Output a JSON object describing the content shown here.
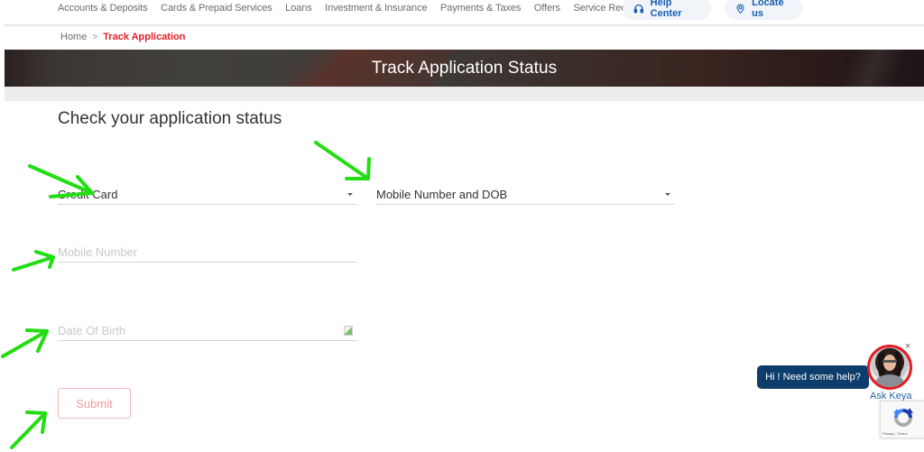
{
  "topnav": {
    "items": [
      "Accounts & Deposits",
      "Cards & Prepaid Services",
      "Loans",
      "Investment & Insurance",
      "Payments & Taxes",
      "Offers",
      "Service Request"
    ],
    "help_center": {
      "label": "Help Center",
      "icon": "headset-icon"
    },
    "locate_us": {
      "label": "Locate us",
      "icon": "location-pin-icon"
    },
    "accent_color": "#1a5fb4"
  },
  "breadcrumb": {
    "home": "Home",
    "separator": ">",
    "current": "Track Application",
    "current_color": "#e31e24"
  },
  "banner": {
    "title": "Track Application Status"
  },
  "form": {
    "title": "Check your application status",
    "product_select": {
      "value": "Credit Card"
    },
    "mode_select": {
      "value": "Mobile Number and DOB"
    },
    "mobile_input": {
      "value": "",
      "placeholder": "Mobile Number"
    },
    "dob_input": {
      "value": "",
      "placeholder": "Date Of Birth",
      "icon": "calendar-icon"
    },
    "submit_label": "Submit"
  },
  "chat": {
    "bubble_text": "Hi ! Need some help?",
    "assistant_name": "Ask Keya",
    "close_label": "×"
  },
  "recaptcha": {
    "terms": "Privacy - Terms"
  },
  "annotations": {
    "color": "#22dd11",
    "count": 6
  }
}
